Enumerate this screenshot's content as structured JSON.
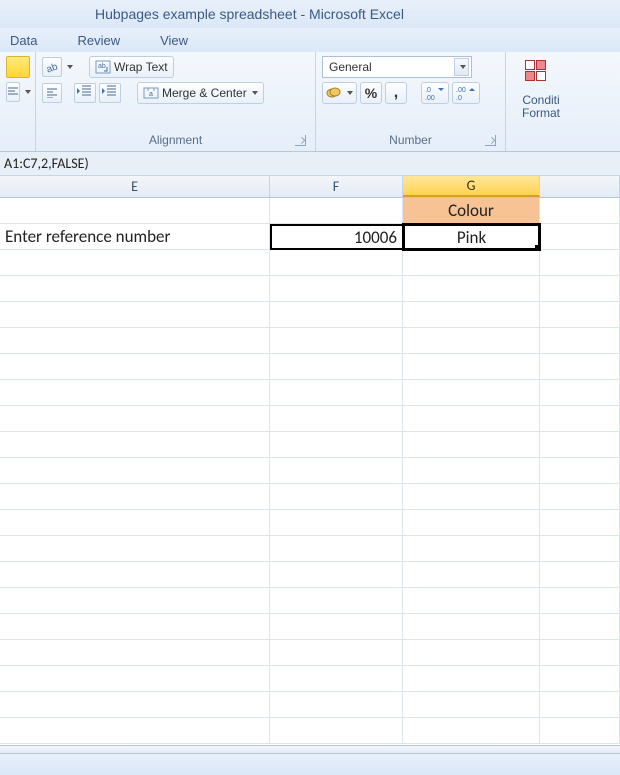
{
  "title_bar": {
    "document": "Hubpages example spreadsheet",
    "separator": " - ",
    "app": "Microsoft Excel"
  },
  "menu": {
    "data": "Data",
    "review": "Review",
    "view": "View"
  },
  "ribbon": {
    "alignment": {
      "wrap_text": "Wrap Text",
      "merge_center": "Merge & Center",
      "group_label": "Alignment"
    },
    "number": {
      "format": "General",
      "percent": "%",
      "comma": ",",
      "increase_decimal_icon": ".00",
      "decrease_decimal_icon": ".00",
      "group_label": "Number"
    },
    "styles": {
      "conditional_line1": "Conditi",
      "conditional_line2": "Format"
    }
  },
  "formula_bar": {
    "formula": "A1:C7,2,FALSE)"
  },
  "columns": {
    "E": "E",
    "F": "F",
    "G": "G"
  },
  "cells": {
    "G1": "Colour",
    "E2": "Enter reference number",
    "F2": "10006",
    "G2": "Pink"
  }
}
